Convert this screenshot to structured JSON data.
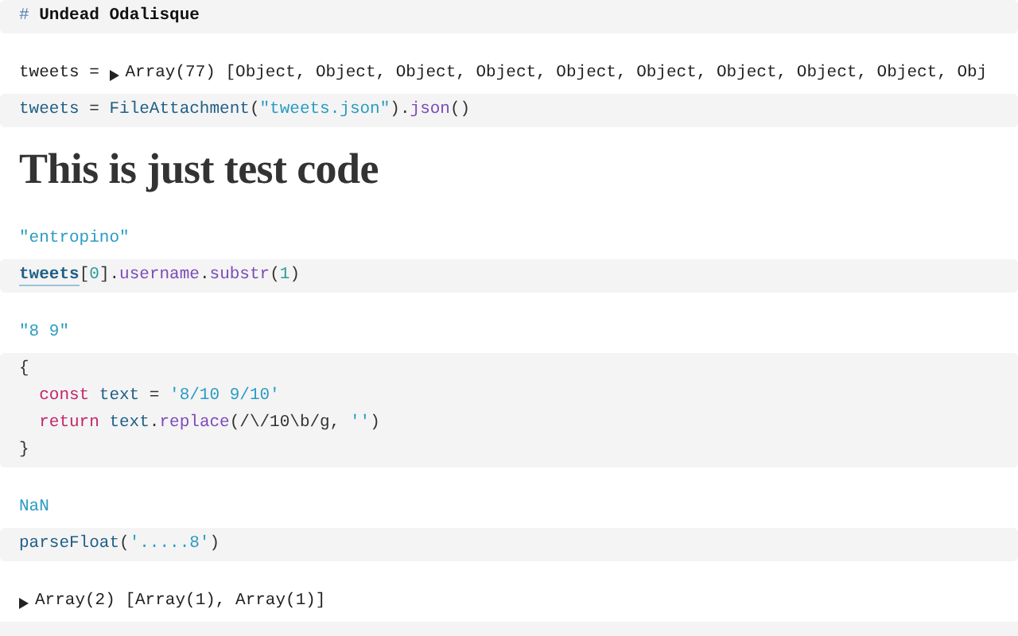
{
  "blocks": [
    {
      "kind": "source",
      "lines": [
        [
          {
            "text": "# ",
            "kind": "hash"
          },
          {
            "text": "Undead Odalisque",
            "kind": "md"
          }
        ]
      ]
    },
    {
      "kind": "inspector",
      "label": "tweets = ",
      "summary": "Array(77) [Object, Object, Object, Object, Object, Object, Object, Object, Object, Obj",
      "expanded": false
    },
    {
      "kind": "source",
      "lines": [
        [
          {
            "text": "tweets",
            "kind": "variable"
          },
          {
            "text": " = ",
            "kind": "plain"
          },
          {
            "text": "FileAttachment",
            "kind": "variable"
          },
          {
            "text": "(",
            "kind": "plain"
          },
          {
            "text": "\"tweets.json\"",
            "kind": "string"
          },
          {
            "text": ").",
            "kind": "plain"
          },
          {
            "text": "json",
            "kind": "property"
          },
          {
            "text": "()",
            "kind": "plain"
          }
        ]
      ]
    },
    {
      "kind": "heading",
      "text": "This is just test code"
    },
    {
      "kind": "value",
      "text": "\"entropino\""
    },
    {
      "kind": "source",
      "lines": [
        [
          {
            "text": "tweets",
            "kind": "reference"
          },
          {
            "text": "[",
            "kind": "plain"
          },
          {
            "text": "0",
            "kind": "number"
          },
          {
            "text": "].",
            "kind": "plain"
          },
          {
            "text": "username",
            "kind": "property"
          },
          {
            "text": ".",
            "kind": "plain"
          },
          {
            "text": "substr",
            "kind": "property"
          },
          {
            "text": "(",
            "kind": "plain"
          },
          {
            "text": "1",
            "kind": "number"
          },
          {
            "text": ")",
            "kind": "plain"
          }
        ]
      ]
    },
    {
      "kind": "value",
      "text": "\"8 9\""
    },
    {
      "kind": "source",
      "lines": [
        {
          "indent": false,
          "tokens": [
            {
              "text": "{",
              "kind": "plain"
            }
          ]
        },
        {
          "indent": true,
          "tokens": [
            {
              "text": "const ",
              "kind": "keyword"
            },
            {
              "text": "text",
              "kind": "variable"
            },
            {
              "text": " = ",
              "kind": "plain"
            },
            {
              "text": "'8/10 9/10'",
              "kind": "string"
            }
          ]
        },
        {
          "indent": true,
          "tokens": [
            {
              "text": "return ",
              "kind": "keyword"
            },
            {
              "text": "text",
              "kind": "variable"
            },
            {
              "text": ".",
              "kind": "plain"
            },
            {
              "text": "replace",
              "kind": "property"
            },
            {
              "text": "(/\\/10\\b/g, ",
              "kind": "plain"
            },
            {
              "text": "''",
              "kind": "string"
            },
            {
              "text": ")",
              "kind": "plain"
            }
          ]
        },
        {
          "indent": false,
          "tokens": [
            {
              "text": "}",
              "kind": "plain"
            }
          ]
        }
      ]
    },
    {
      "kind": "value",
      "text": "NaN"
    },
    {
      "kind": "source",
      "lines": [
        [
          {
            "text": "parseFloat",
            "kind": "variable"
          },
          {
            "text": "(",
            "kind": "plain"
          },
          {
            "text": "'.....8'",
            "kind": "string"
          },
          {
            "text": ")",
            "kind": "plain"
          }
        ]
      ]
    },
    {
      "kind": "inspector",
      "summary": "Array(2) [Array(1), Array(1)]",
      "expanded": false
    }
  ]
}
